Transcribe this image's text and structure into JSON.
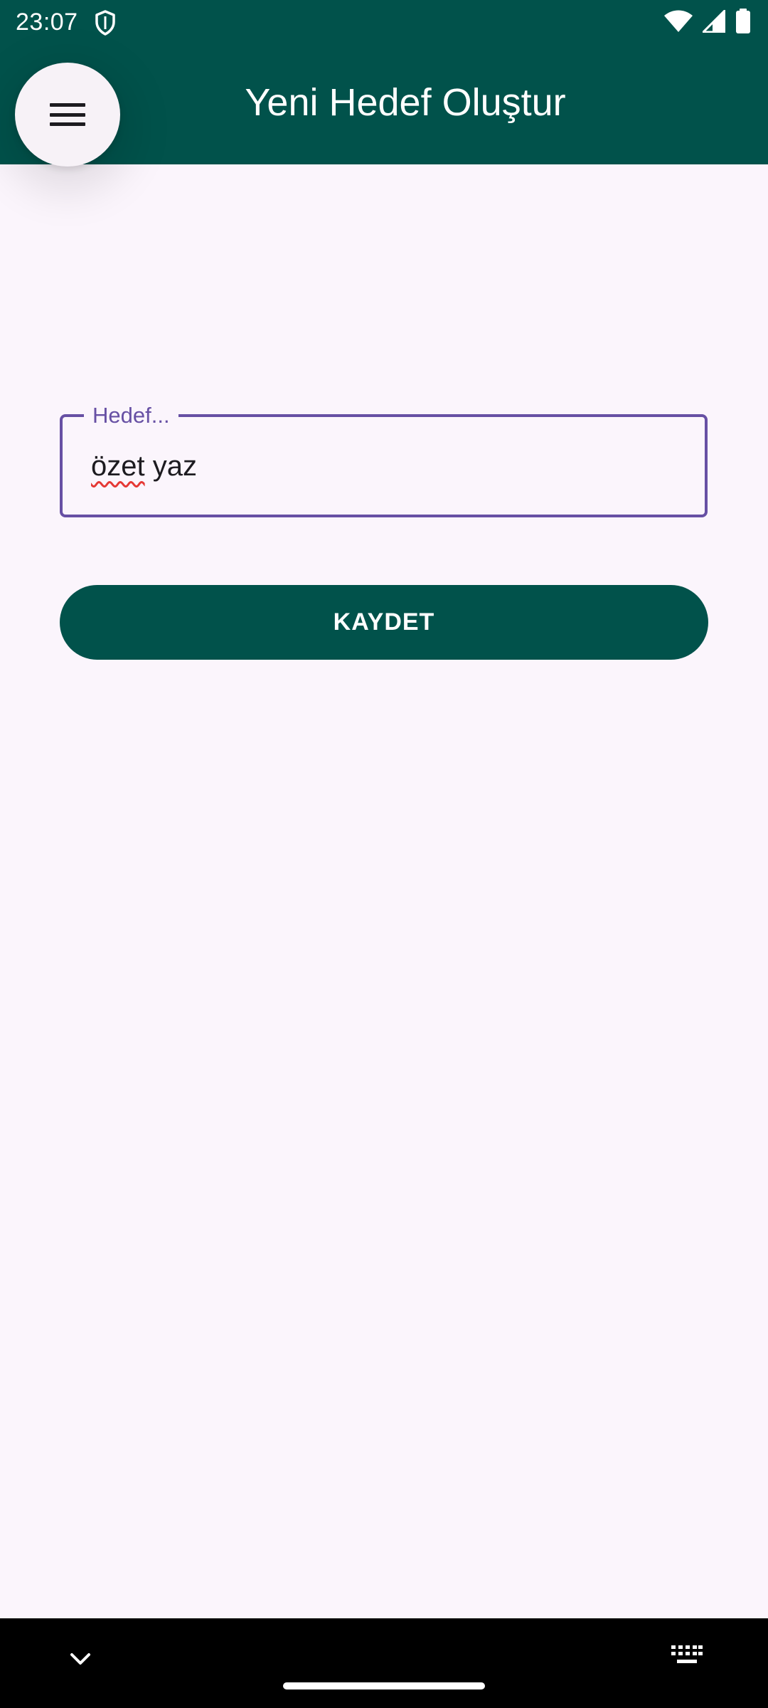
{
  "status_bar": {
    "time": "23:07",
    "icons": [
      "shield-icon",
      "wifi-icon",
      "signal-icon",
      "battery-icon"
    ]
  },
  "app_bar": {
    "title": "Yeni Hedef Oluştur",
    "menu_icon": "hamburger-menu-icon"
  },
  "form": {
    "goal_field": {
      "label": "Hedef...",
      "value_word_1": "özet",
      "value_word_2": " yaz"
    },
    "save_label": "KAYDET"
  },
  "nav_bar": {
    "icons": [
      "chevron-down-icon",
      "home-handle",
      "keyboard-icon"
    ]
  },
  "colors": {
    "primary": "#01524B",
    "accent": "#6750A4",
    "background": "#FBF5FC",
    "error": "#E53935"
  }
}
